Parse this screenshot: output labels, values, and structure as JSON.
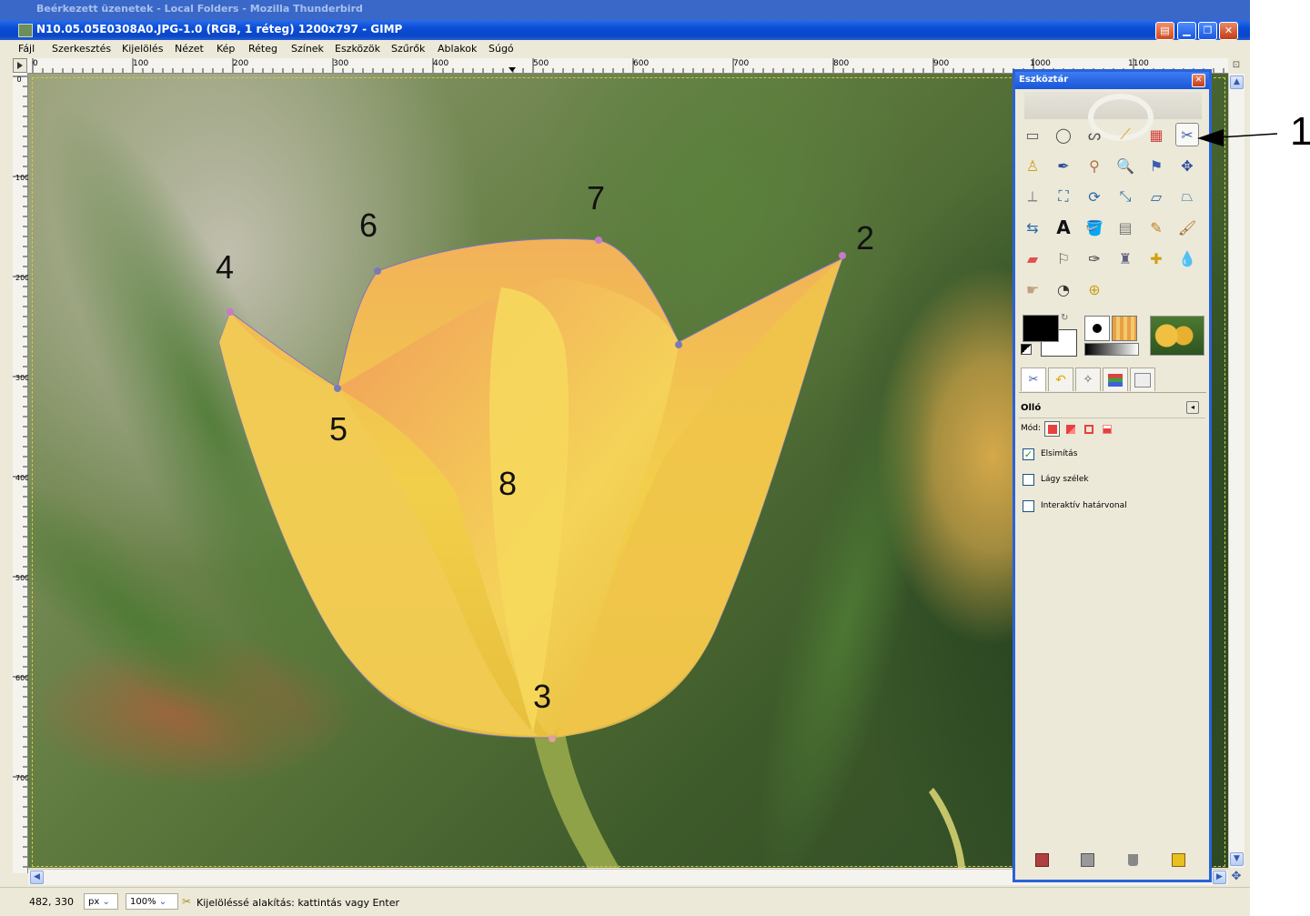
{
  "window": {
    "bg_title": "Beérkezett üzenetek - Local Folders - Mozilla Thunderbird",
    "title": "N10.05.05E0308A0.JPG-1.0 (RGB, 1 réteg) 1200x797 - GIMP"
  },
  "menu": [
    "Fájl",
    "Szerkesztés",
    "Kijelölés",
    "Nézet",
    "Kép",
    "Réteg",
    "Színek",
    "Eszközök",
    "Szűrők",
    "Ablakok",
    "Súgó"
  ],
  "ruler": {
    "h_labels": [
      "0",
      "100",
      "200",
      "300",
      "400",
      "500",
      "600",
      "700",
      "800",
      "900",
      "1000",
      "1100"
    ],
    "v_labels": [
      "0",
      "100",
      "200",
      "300",
      "400",
      "500",
      "600",
      "700"
    ]
  },
  "annotations": {
    "n1": "1",
    "n2": "2",
    "n3": "3",
    "n4": "4",
    "n5": "5",
    "n6": "6",
    "n7": "7",
    "n8": "8"
  },
  "toolbox": {
    "title": "Eszköztár",
    "tools": [
      "rect-select-icon",
      "ellipse-select-icon",
      "free-select-icon",
      "fuzzy-select-icon",
      "select-by-color-icon",
      "scissors-icon",
      "foreground-select-icon",
      "paths-icon",
      "color-picker-icon",
      "zoom-lens-icon",
      "measure-icon",
      "move-icon",
      "align-icon",
      "crop-icon",
      "rotate-icon",
      "scale-icon",
      "shear-icon",
      "perspective-icon",
      "flip-icon",
      "text-icon",
      "bucket-fill-icon",
      "blend-icon",
      "pencil-icon",
      "paintbrush-icon",
      "eraser-icon",
      "airbrush-icon",
      "ink-icon",
      "clone-icon",
      "heal-icon",
      "blur-icon",
      "smudge-icon",
      "dodge-burn-icon",
      "magnify-icon"
    ],
    "options": {
      "name": "Olló",
      "mode_label": "Mód:",
      "antialias": "Elsimítás",
      "feather": "Lágy szélek",
      "interactive": "Interaktív határvonal",
      "antialias_checked": true,
      "feather_checked": false,
      "interactive_checked": false
    }
  },
  "status": {
    "coords": "482, 330",
    "unit": "px",
    "zoom": "100%",
    "message": "Kijelöléssé alakítás: kattintás vagy Enter"
  },
  "colors": {
    "accent": "#2a62d8",
    "selection": "#6a6ad8"
  }
}
